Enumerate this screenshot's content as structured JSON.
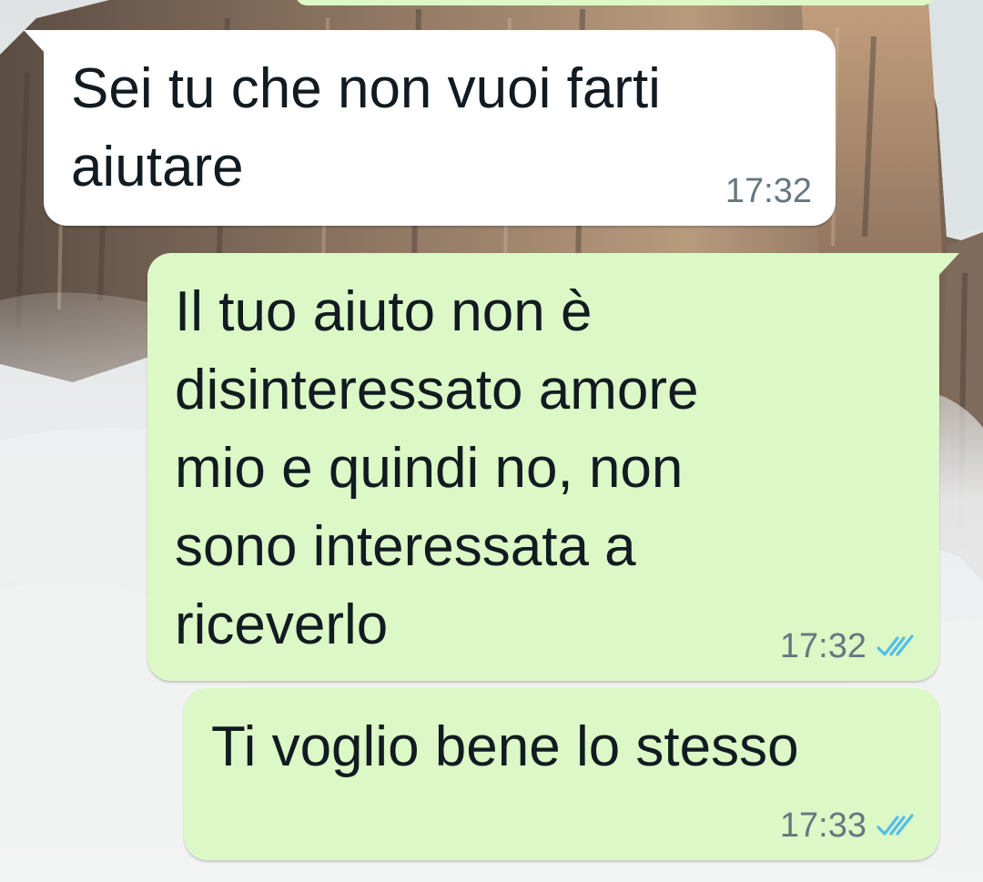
{
  "conversation": {
    "messages": [
      {
        "direction": "incoming",
        "text": "Sei tu che non vuoi farti\naiutare",
        "time": "17:32"
      },
      {
        "direction": "outgoing",
        "text": "Il tuo aiuto non è\ndisinteressato amore\nmio e quindi no, non\nsono interessata a\nriceverlo",
        "time": "17:32",
        "status_icon": "double-check-icon",
        "status_color": "#53bdeb"
      },
      {
        "direction": "outgoing",
        "text": "Ti voglio bene lo stesso",
        "time": "17:33",
        "status_icon": "double-check-icon",
        "status_color": "#53bdeb"
      }
    ]
  },
  "colors": {
    "incoming_bubble": "#ffffff",
    "outgoing_bubble": "#dcf8c6",
    "text": "#111b21",
    "meta": "#667781"
  },
  "wallpaper": {
    "subject": "mountain-cliffs-with-clouds"
  }
}
